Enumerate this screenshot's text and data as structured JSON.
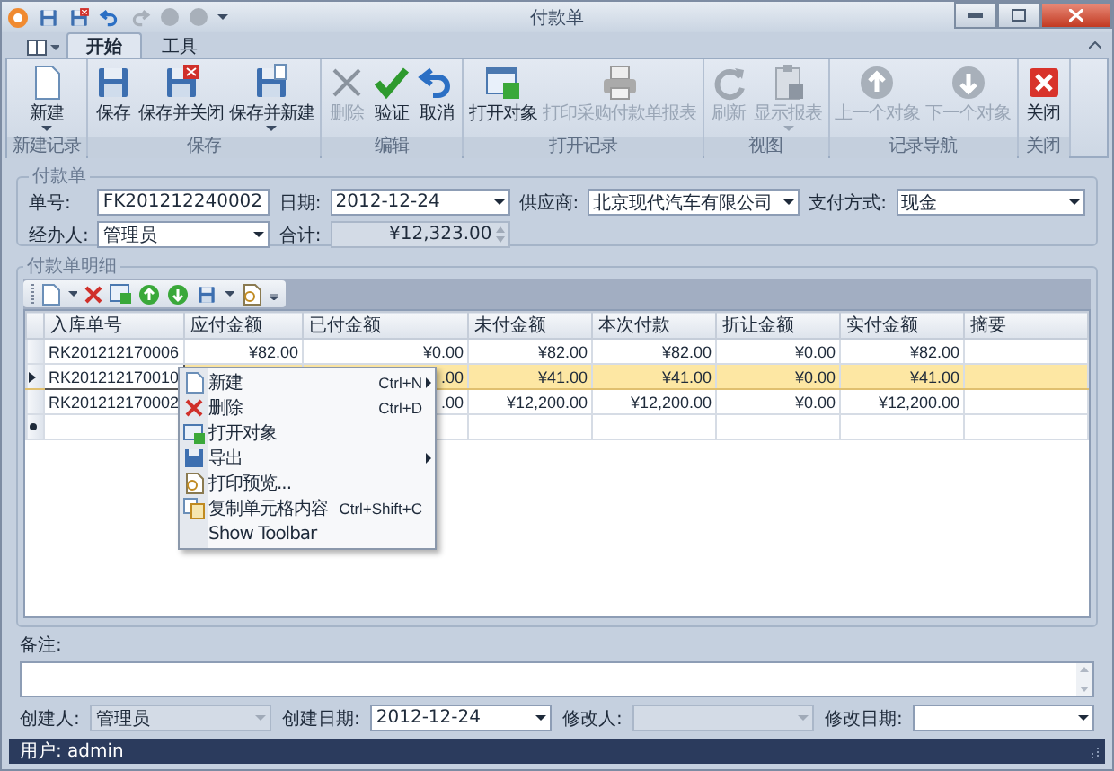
{
  "window": {
    "title": "付款单"
  },
  "ribbon": {
    "tabs": [
      {
        "label": "开始",
        "selected": true
      },
      {
        "label": "工具",
        "selected": false
      }
    ],
    "groups": [
      {
        "label": "新建记录",
        "buttons": [
          {
            "label": "新建",
            "disabled": false,
            "dropdown": true
          }
        ]
      },
      {
        "label": "保存",
        "buttons": [
          {
            "label": "保存",
            "disabled": false,
            "dropdown": false
          },
          {
            "label": "保存并关闭",
            "disabled": false,
            "dropdown": false
          },
          {
            "label": "保存并新建",
            "disabled": false,
            "dropdown": true
          }
        ]
      },
      {
        "label": "编辑",
        "buttons": [
          {
            "label": "删除",
            "disabled": true,
            "dropdown": false
          },
          {
            "label": "验证",
            "disabled": false,
            "dropdown": false
          },
          {
            "label": "取消",
            "disabled": false,
            "dropdown": false
          }
        ]
      },
      {
        "label": "打开记录",
        "buttons": [
          {
            "label": "打开对象",
            "disabled": false,
            "dropdown": false
          },
          {
            "label": "打印采购付款单报表",
            "disabled": true,
            "dropdown": false
          }
        ]
      },
      {
        "label": "视图",
        "buttons": [
          {
            "label": "刷新",
            "disabled": true,
            "dropdown": false
          },
          {
            "label": "显示报表",
            "disabled": true,
            "dropdown": true
          }
        ]
      },
      {
        "label": "记录导航",
        "buttons": [
          {
            "label": "上一个对象",
            "disabled": true,
            "dropdown": false
          },
          {
            "label": "下一个对象",
            "disabled": true,
            "dropdown": false
          }
        ]
      },
      {
        "label": "关闭",
        "buttons": [
          {
            "label": "关闭",
            "disabled": false,
            "dropdown": false
          }
        ]
      }
    ]
  },
  "header_form": {
    "title": "付款单",
    "fields": [
      {
        "label": "单号:",
        "kind": "text",
        "value": "FK201212240002",
        "disabled": false
      },
      {
        "label": "日期:",
        "kind": "combo",
        "value": "2012-12-24",
        "disabled": false
      },
      {
        "label": "供应商:",
        "kind": "combo",
        "value": "北京现代汽车有限公司",
        "disabled": false
      },
      {
        "label": "支付方式:",
        "kind": "combo",
        "value": "现金",
        "disabled": false
      },
      {
        "label": "经办人:",
        "kind": "combo",
        "value": "管理员",
        "disabled": false
      },
      {
        "label": "合计:",
        "kind": "spin",
        "value": "¥12,323.00",
        "disabled": true
      }
    ]
  },
  "detail": {
    "title": "付款单明细",
    "table": {
      "columns": [
        "入库单号",
        "应付金额",
        "已付金额",
        "未付金额",
        "本次付款",
        "折让金额",
        "实付金额",
        "摘要"
      ],
      "rows": [
        {
          "selected": false,
          "cells": [
            "RK201212170006",
            "¥82.00",
            "¥0.00",
            "¥82.00",
            "¥82.00",
            "¥0.00",
            "¥82.00"
          ]
        },
        {
          "selected": true,
          "cells": [
            "RK201212170010",
            null,
            ".00",
            "¥41.00",
            "¥41.00",
            "¥0.00",
            "¥41.00"
          ]
        },
        {
          "selected": false,
          "cells": [
            "RK201212170002",
            null,
            ".00",
            "¥12,200.00",
            "¥12,200.00",
            "¥0.00",
            "¥12,200.00"
          ]
        }
      ]
    }
  },
  "context_menu": {
    "items": [
      {
        "label": "新建",
        "shortcut": "Ctrl+N",
        "submenu": true
      },
      {
        "label": "删除",
        "shortcut": "Ctrl+D",
        "submenu": false
      },
      {
        "label": "打开对象",
        "submenu": false
      },
      {
        "label": "导出",
        "submenu": true
      },
      {
        "label": "打印预览...",
        "submenu": false
      },
      {
        "label": "复制单元格内容",
        "shortcut": "Ctrl+Shift+C",
        "submenu": false
      },
      {
        "label": "Show Toolbar",
        "submenu": false
      }
    ]
  },
  "remarks": {
    "label": "备注:"
  },
  "footer_fields": [
    {
      "label": "创建人:",
      "kind": "combo",
      "value": "管理员",
      "disabled": true
    },
    {
      "label": "创建日期:",
      "kind": "combo",
      "value": "2012-12-24",
      "disabled": false
    },
    {
      "label": "修改人:",
      "kind": "combo",
      "disabled": true
    },
    {
      "label": "修改日期:",
      "kind": "combo",
      "disabled": false
    }
  ],
  "status_bar": {
    "text": "用户: admin"
  }
}
